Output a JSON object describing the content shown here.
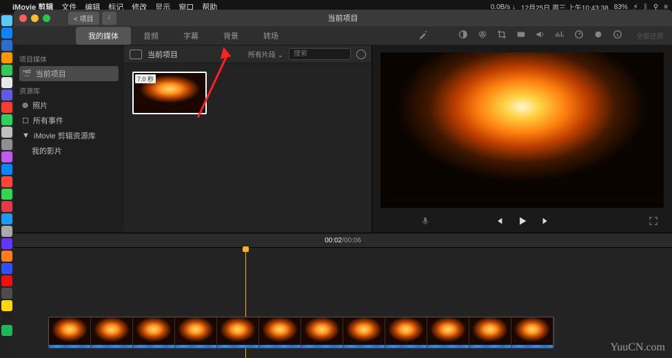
{
  "menubar": {
    "app": "iMovie 剪辑",
    "items": [
      "文件",
      "编辑",
      "标记",
      "修改",
      "显示",
      "窗口",
      "帮助"
    ],
    "date": "12月25日 周三 上午10:43:38",
    "net": "0.0B/s ↓",
    "battery": "83%"
  },
  "window": {
    "title": "当前项目",
    "back_label": "< 项目",
    "import_icon": "↓"
  },
  "tabs": {
    "items": [
      "我的媒体",
      "音频",
      "字幕",
      "背景",
      "转场"
    ],
    "active": 0
  },
  "tool_icons": [
    "wand",
    "balance",
    "palette",
    "crop",
    "video",
    "speaker",
    "eq",
    "speed",
    "filter",
    "info"
  ],
  "toolbar_reset": "全部还原",
  "sidebar": {
    "section1": "项目媒体",
    "current": "当前项目",
    "section2": "资源库",
    "photos": "照片",
    "all_events": "所有事件",
    "library": "iMovie 剪辑资源库",
    "my_movies": "我的影片"
  },
  "browser": {
    "title": "当前项目",
    "filter": "所有片段",
    "search_placeholder": "搜索",
    "clip_duration": "7.0 秒"
  },
  "time": {
    "current": "00:02",
    "sep": " / ",
    "total": "00:06"
  },
  "timeline": {
    "clip_count": 12
  },
  "dock_colors": [
    "#5ac8fa",
    "#0a84ff",
    "#2a6fd0",
    "#ff9500",
    "#34c759",
    "#e8e8e8",
    "#5e5ce6",
    "#ff3b30",
    "#30d158",
    "#c0c0c0",
    "#8e8e93",
    "#bf5af2",
    "#0a84ff",
    "#ff453a",
    "#32d74b",
    "#e63946",
    "#1d9bf0",
    "#aaa",
    "#6236ff",
    "#ff7d1a",
    "#304ffe",
    "#e11",
    "#4d4d4d",
    "#ffd60a",
    "#222",
    "#1db954"
  ],
  "watermark": "YuuCN.com"
}
